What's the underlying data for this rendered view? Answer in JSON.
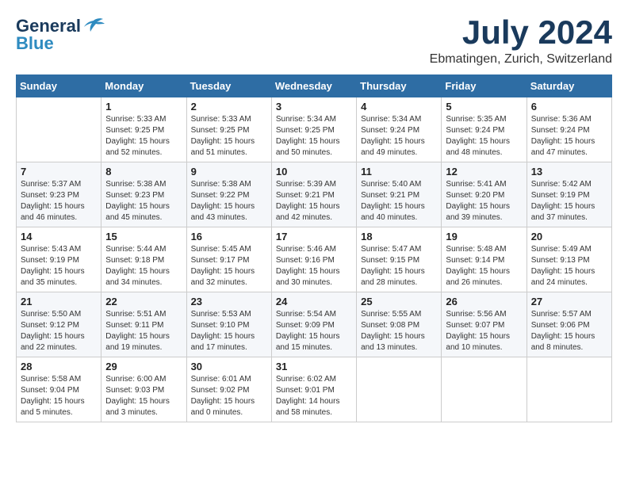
{
  "header": {
    "logo_general": "General",
    "logo_blue": "Blue",
    "month_year": "July 2024",
    "location": "Ebmatingen, Zurich, Switzerland"
  },
  "weekdays": [
    "Sunday",
    "Monday",
    "Tuesday",
    "Wednesday",
    "Thursday",
    "Friday",
    "Saturday"
  ],
  "weeks": [
    [
      null,
      {
        "day": "1",
        "sunrise": "Sunrise: 5:33 AM",
        "sunset": "Sunset: 9:25 PM",
        "daylight": "Daylight: 15 hours and 52 minutes."
      },
      {
        "day": "2",
        "sunrise": "Sunrise: 5:33 AM",
        "sunset": "Sunset: 9:25 PM",
        "daylight": "Daylight: 15 hours and 51 minutes."
      },
      {
        "day": "3",
        "sunrise": "Sunrise: 5:34 AM",
        "sunset": "Sunset: 9:25 PM",
        "daylight": "Daylight: 15 hours and 50 minutes."
      },
      {
        "day": "4",
        "sunrise": "Sunrise: 5:34 AM",
        "sunset": "Sunset: 9:24 PM",
        "daylight": "Daylight: 15 hours and 49 minutes."
      },
      {
        "day": "5",
        "sunrise": "Sunrise: 5:35 AM",
        "sunset": "Sunset: 9:24 PM",
        "daylight": "Daylight: 15 hours and 48 minutes."
      },
      {
        "day": "6",
        "sunrise": "Sunrise: 5:36 AM",
        "sunset": "Sunset: 9:24 PM",
        "daylight": "Daylight: 15 hours and 47 minutes."
      }
    ],
    [
      {
        "day": "7",
        "sunrise": "Sunrise: 5:37 AM",
        "sunset": "Sunset: 9:23 PM",
        "daylight": "Daylight: 15 hours and 46 minutes."
      },
      {
        "day": "8",
        "sunrise": "Sunrise: 5:38 AM",
        "sunset": "Sunset: 9:23 PM",
        "daylight": "Daylight: 15 hours and 45 minutes."
      },
      {
        "day": "9",
        "sunrise": "Sunrise: 5:38 AM",
        "sunset": "Sunset: 9:22 PM",
        "daylight": "Daylight: 15 hours and 43 minutes."
      },
      {
        "day": "10",
        "sunrise": "Sunrise: 5:39 AM",
        "sunset": "Sunset: 9:21 PM",
        "daylight": "Daylight: 15 hours and 42 minutes."
      },
      {
        "day": "11",
        "sunrise": "Sunrise: 5:40 AM",
        "sunset": "Sunset: 9:21 PM",
        "daylight": "Daylight: 15 hours and 40 minutes."
      },
      {
        "day": "12",
        "sunrise": "Sunrise: 5:41 AM",
        "sunset": "Sunset: 9:20 PM",
        "daylight": "Daylight: 15 hours and 39 minutes."
      },
      {
        "day": "13",
        "sunrise": "Sunrise: 5:42 AM",
        "sunset": "Sunset: 9:19 PM",
        "daylight": "Daylight: 15 hours and 37 minutes."
      }
    ],
    [
      {
        "day": "14",
        "sunrise": "Sunrise: 5:43 AM",
        "sunset": "Sunset: 9:19 PM",
        "daylight": "Daylight: 15 hours and 35 minutes."
      },
      {
        "day": "15",
        "sunrise": "Sunrise: 5:44 AM",
        "sunset": "Sunset: 9:18 PM",
        "daylight": "Daylight: 15 hours and 34 minutes."
      },
      {
        "day": "16",
        "sunrise": "Sunrise: 5:45 AM",
        "sunset": "Sunset: 9:17 PM",
        "daylight": "Daylight: 15 hours and 32 minutes."
      },
      {
        "day": "17",
        "sunrise": "Sunrise: 5:46 AM",
        "sunset": "Sunset: 9:16 PM",
        "daylight": "Daylight: 15 hours and 30 minutes."
      },
      {
        "day": "18",
        "sunrise": "Sunrise: 5:47 AM",
        "sunset": "Sunset: 9:15 PM",
        "daylight": "Daylight: 15 hours and 28 minutes."
      },
      {
        "day": "19",
        "sunrise": "Sunrise: 5:48 AM",
        "sunset": "Sunset: 9:14 PM",
        "daylight": "Daylight: 15 hours and 26 minutes."
      },
      {
        "day": "20",
        "sunrise": "Sunrise: 5:49 AM",
        "sunset": "Sunset: 9:13 PM",
        "daylight": "Daylight: 15 hours and 24 minutes."
      }
    ],
    [
      {
        "day": "21",
        "sunrise": "Sunrise: 5:50 AM",
        "sunset": "Sunset: 9:12 PM",
        "daylight": "Daylight: 15 hours and 22 minutes."
      },
      {
        "day": "22",
        "sunrise": "Sunrise: 5:51 AM",
        "sunset": "Sunset: 9:11 PM",
        "daylight": "Daylight: 15 hours and 19 minutes."
      },
      {
        "day": "23",
        "sunrise": "Sunrise: 5:53 AM",
        "sunset": "Sunset: 9:10 PM",
        "daylight": "Daylight: 15 hours and 17 minutes."
      },
      {
        "day": "24",
        "sunrise": "Sunrise: 5:54 AM",
        "sunset": "Sunset: 9:09 PM",
        "daylight": "Daylight: 15 hours and 15 minutes."
      },
      {
        "day": "25",
        "sunrise": "Sunrise: 5:55 AM",
        "sunset": "Sunset: 9:08 PM",
        "daylight": "Daylight: 15 hours and 13 minutes."
      },
      {
        "day": "26",
        "sunrise": "Sunrise: 5:56 AM",
        "sunset": "Sunset: 9:07 PM",
        "daylight": "Daylight: 15 hours and 10 minutes."
      },
      {
        "day": "27",
        "sunrise": "Sunrise: 5:57 AM",
        "sunset": "Sunset: 9:06 PM",
        "daylight": "Daylight: 15 hours and 8 minutes."
      }
    ],
    [
      {
        "day": "28",
        "sunrise": "Sunrise: 5:58 AM",
        "sunset": "Sunset: 9:04 PM",
        "daylight": "Daylight: 15 hours and 5 minutes."
      },
      {
        "day": "29",
        "sunrise": "Sunrise: 6:00 AM",
        "sunset": "Sunset: 9:03 PM",
        "daylight": "Daylight: 15 hours and 3 minutes."
      },
      {
        "day": "30",
        "sunrise": "Sunrise: 6:01 AM",
        "sunset": "Sunset: 9:02 PM",
        "daylight": "Daylight: 15 hours and 0 minutes."
      },
      {
        "day": "31",
        "sunrise": "Sunrise: 6:02 AM",
        "sunset": "Sunset: 9:01 PM",
        "daylight": "Daylight: 14 hours and 58 minutes."
      },
      null,
      null,
      null
    ]
  ]
}
